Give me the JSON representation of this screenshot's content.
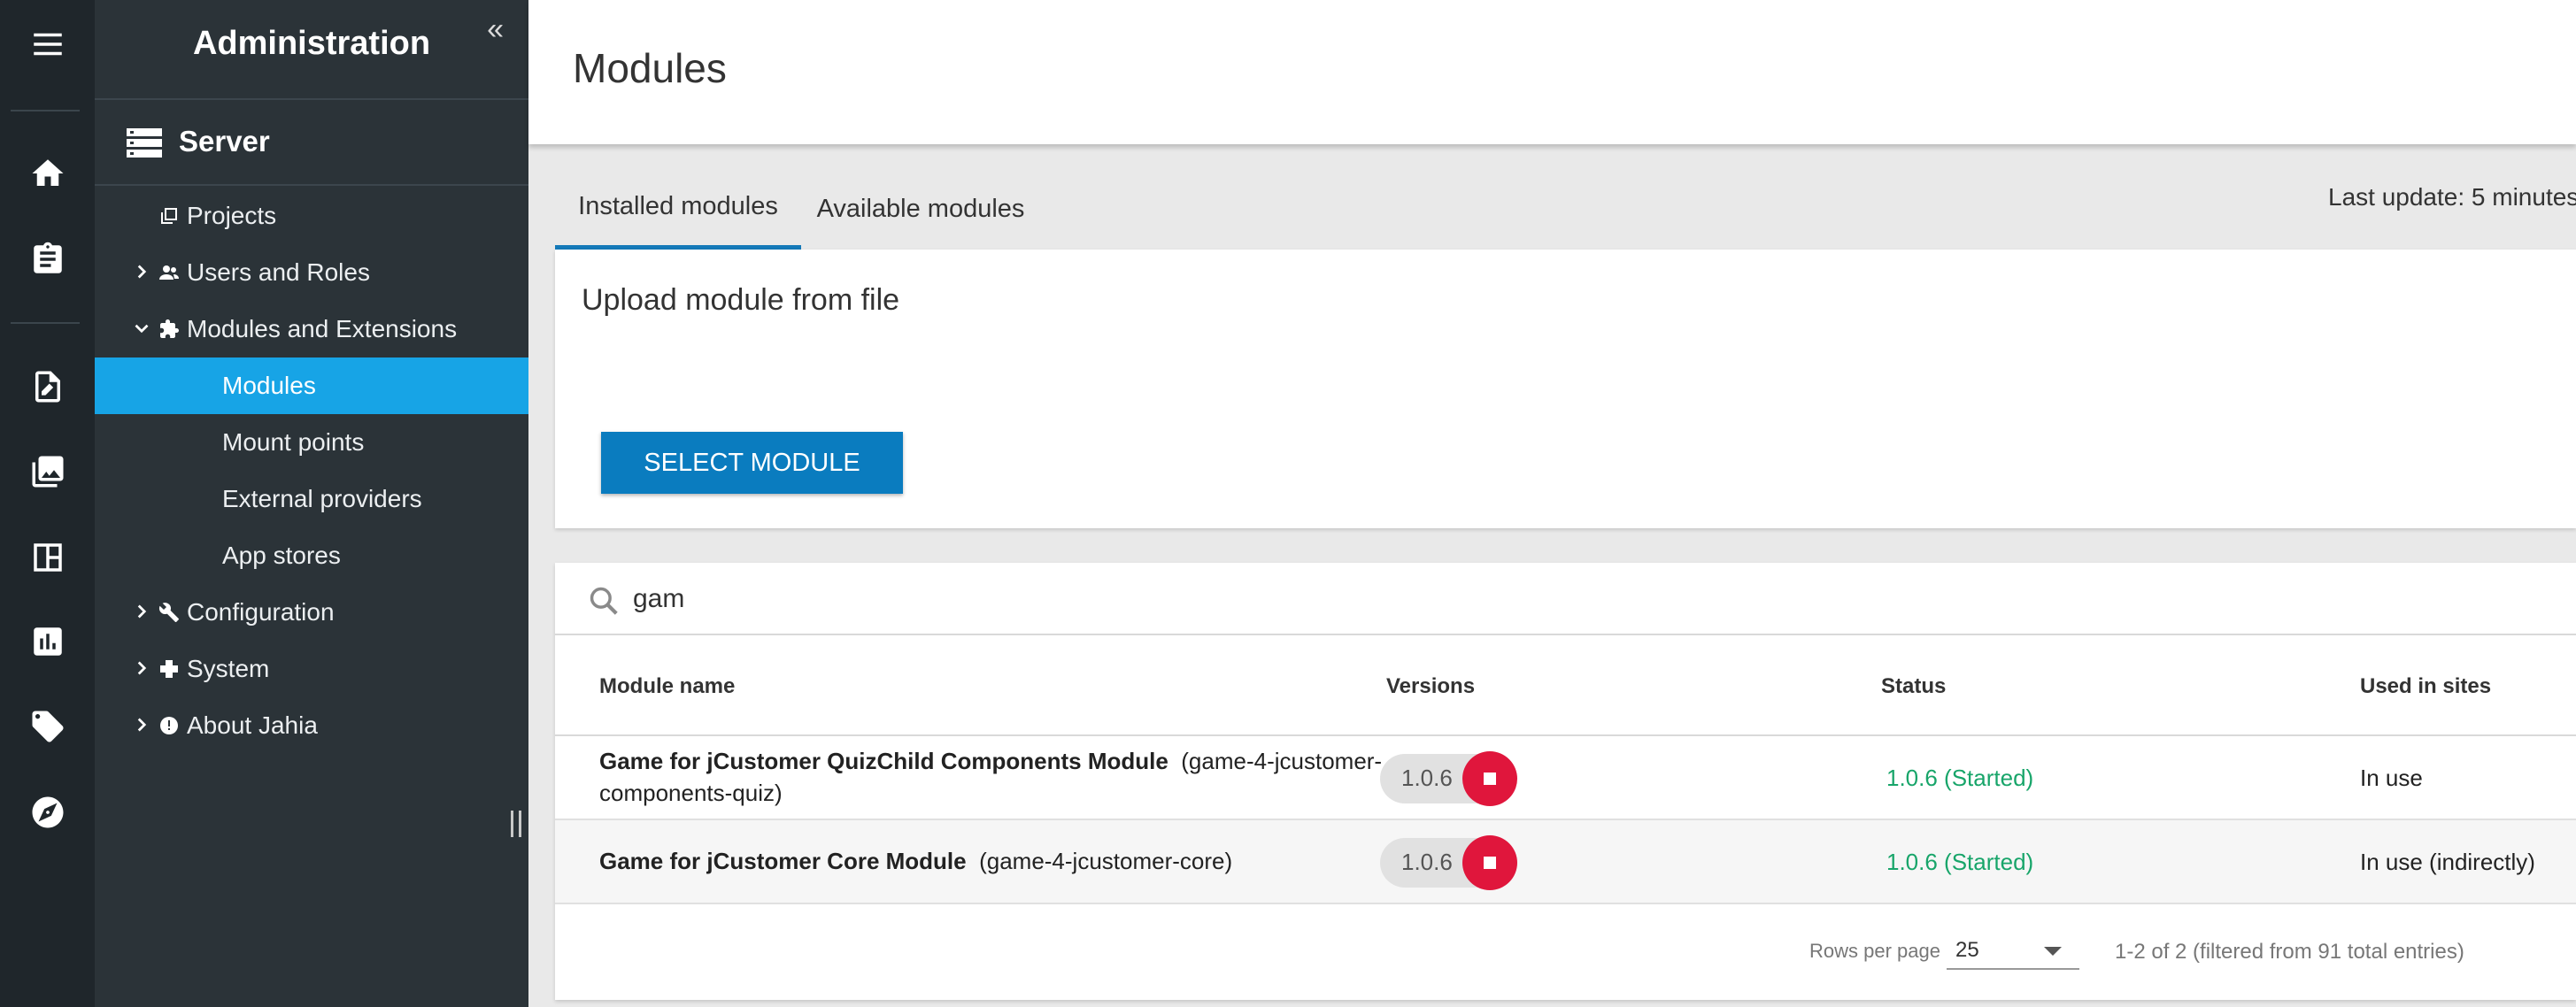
{
  "rail": {
    "items": [
      "menu-icon",
      "home-icon",
      "clipboard-icon",
      "edit-document-icon",
      "images-icon",
      "dashboard-icon",
      "analytics-icon",
      "tag-icon",
      "compass-icon"
    ]
  },
  "sidebar": {
    "title": "Administration",
    "collapse_glyph": "«",
    "section": "Server",
    "items": [
      {
        "label": "Projects"
      },
      {
        "label": "Users and Roles"
      },
      {
        "label": "Modules and Extensions"
      },
      {
        "label": "Modules"
      },
      {
        "label": "Mount points"
      },
      {
        "label": "External providers"
      },
      {
        "label": "App stores"
      },
      {
        "label": "Configuration"
      },
      {
        "label": "System"
      },
      {
        "label": "About Jahia"
      }
    ]
  },
  "page": {
    "title": "Modules",
    "tabs": [
      {
        "label": "Installed modules"
      },
      {
        "label": "Available modules"
      }
    ],
    "last_update": "Last update: 5 minutes"
  },
  "upload": {
    "title": "Upload module from file",
    "button": "SELECT MODULE"
  },
  "table": {
    "search_value": "gam",
    "headers": {
      "name": "Module name",
      "versions": "Versions",
      "status": "Status",
      "used": "Used in sites"
    },
    "rows": [
      {
        "name": "Game for jCustomer QuizChild Components Module",
        "id_line1": "(game-4-jcustomer-",
        "id_line2": "components-quiz)",
        "version": "1.0.6",
        "status": "1.0.6 (Started)",
        "used": "In use"
      },
      {
        "name": "Game for jCustomer Core Module",
        "id": "(game-4-jcustomer-core)",
        "version": "1.0.6",
        "status": "1.0.6 (Started)",
        "used": "In use (indirectly)"
      }
    ],
    "footer": {
      "rows_per_page_label": "Rows per page",
      "rows_per_page_value": "25",
      "range": "1-2 of 2 (filtered from 91 total entries)"
    }
  },
  "colors": {
    "rail_bg": "#1f262b",
    "sidebar_bg": "#2b3338",
    "active_item": "#17a4e6",
    "primary_button": "#0a7cbf",
    "stop_button": "#e0163c",
    "status_green": "#18a56a"
  }
}
